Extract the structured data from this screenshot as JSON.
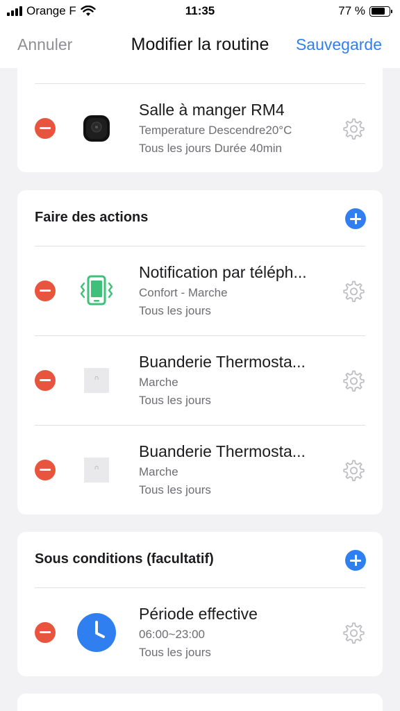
{
  "status_bar": {
    "carrier": "Orange F",
    "time": "11:35",
    "battery": "77 %",
    "battery_level": 0.77
  },
  "nav": {
    "cancel": "Annuler",
    "title": "Modifier la routine",
    "save": "Sauvegarde"
  },
  "top_card": {
    "rows": [
      {
        "name": "Salle à manger RM4",
        "line1": "Temperature Descendre20°C",
        "line2": "Tous les jours Durée 40min",
        "icon": "rm4-device-icon"
      }
    ]
  },
  "actions_card": {
    "title": "Faire des actions",
    "rows": [
      {
        "name": "Notification par téléph...",
        "line1": "Confort - Marche",
        "line2": "Tous les jours",
        "icon": "phone-vibrate-icon"
      },
      {
        "name": "Buanderie Thermosta...",
        "line1": "Marche",
        "line2": "Tous les jours",
        "icon": "device-thumbnail-icon"
      },
      {
        "name": "Buanderie Thermosta...",
        "line1": "Marche",
        "line2": "Tous les jours",
        "icon": "device-thumbnail-icon"
      }
    ]
  },
  "conditions_card": {
    "title": "Sous conditions (facultatif)",
    "rows": [
      {
        "name": "Période effective",
        "line1": "06:00~23:00",
        "line2": "Tous les jours",
        "icon": "clock-icon"
      }
    ]
  },
  "colors": {
    "accent_blue": "#2f7ff0",
    "remove_red": "#e8553f",
    "phone_green": "#3fc07a",
    "background": "#f2f2f4"
  }
}
